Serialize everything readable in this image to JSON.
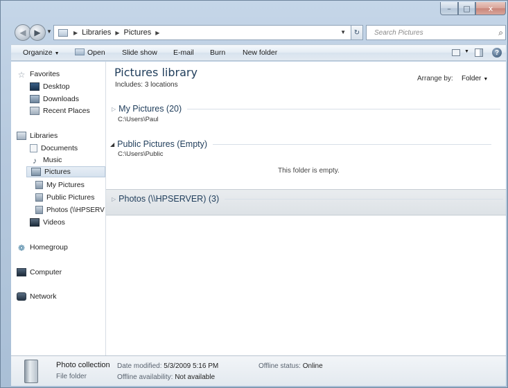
{
  "window": {
    "controls": {
      "minimize": "–",
      "maximize": "□",
      "close": "x"
    }
  },
  "address": {
    "crumbs": [
      "Libraries",
      "Pictures"
    ],
    "search_placeholder": "Search Pictures"
  },
  "toolbar": {
    "organize": "Organize",
    "open": "Open",
    "slideshow": "Slide show",
    "email": "E-mail",
    "burn": "Burn",
    "new_folder": "New folder",
    "help": "?"
  },
  "nav": {
    "favorites": "Favorites",
    "desktop": "Desktop",
    "downloads": "Downloads",
    "recent_places": "Recent Places",
    "libraries": "Libraries",
    "documents": "Documents",
    "music": "Music",
    "pictures": "Pictures",
    "my_pictures": "My Pictures",
    "public_pictures": "Public Pictures",
    "photos": "Photos (\\\\HPSERV",
    "videos": "Videos",
    "homegroup": "Homegroup",
    "computer": "Computer",
    "network": "Network"
  },
  "content": {
    "title": "Pictures library",
    "includes_label": "Includes:",
    "includes_value": "3 locations",
    "arrange_label": "Arrange by:",
    "arrange_value": "Folder",
    "groups": [
      {
        "name": "My Pictures (20)",
        "path": "C:\\Users\\Paul"
      },
      {
        "name": "Public Pictures (Empty)",
        "path": "C:\\Users\\Public",
        "empty_msg": "This folder is empty."
      },
      {
        "name": "Photos (\\\\HPSERVER) (3)"
      }
    ]
  },
  "details": {
    "name": "Photo collection",
    "type": "File folder",
    "date_label": "Date modified:",
    "date_value": "5/3/2009 5:16 PM",
    "avail_label": "Offline availability:",
    "avail_value": "Not available",
    "status_label": "Offline status:",
    "status_value": "Online"
  }
}
